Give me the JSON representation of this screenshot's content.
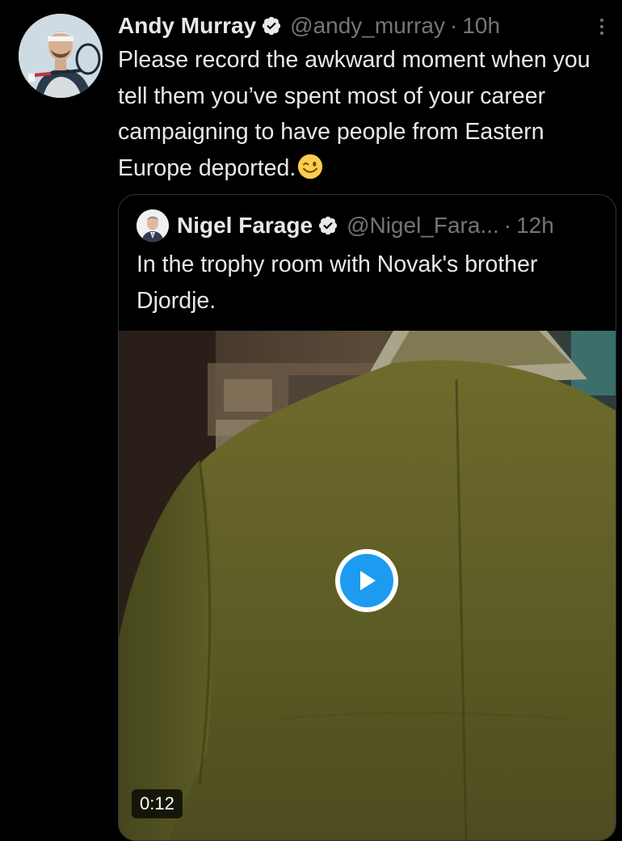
{
  "tweet": {
    "author_name": "Andy Murray",
    "handle": "@andy_murray",
    "separator": "·",
    "time": "10h",
    "text": "Please record the awkward moment when you tell them you’ve spent most of your career campaigning to have people from Eastern Europe deported.",
    "emoji_icon": "winking-face-emoji",
    "verified_icon": "verified-badge-icon",
    "more_icon": "more-options-icon"
  },
  "quoted_tweet": {
    "author_name": "Nigel Farage",
    "handle": "@Nigel_Fara...",
    "separator": "·",
    "time": "12h",
    "text": "In the trophy room with Novak's brother Djordje.",
    "verified_icon": "verified-badge-icon"
  },
  "video": {
    "duration": "0:12",
    "play_icon": "play-icon"
  },
  "colors": {
    "background": "#000000",
    "primary_text": "#e7e9ea",
    "secondary_text": "#71767b",
    "border": "#2f3336",
    "accent": "#1d9bf0"
  }
}
